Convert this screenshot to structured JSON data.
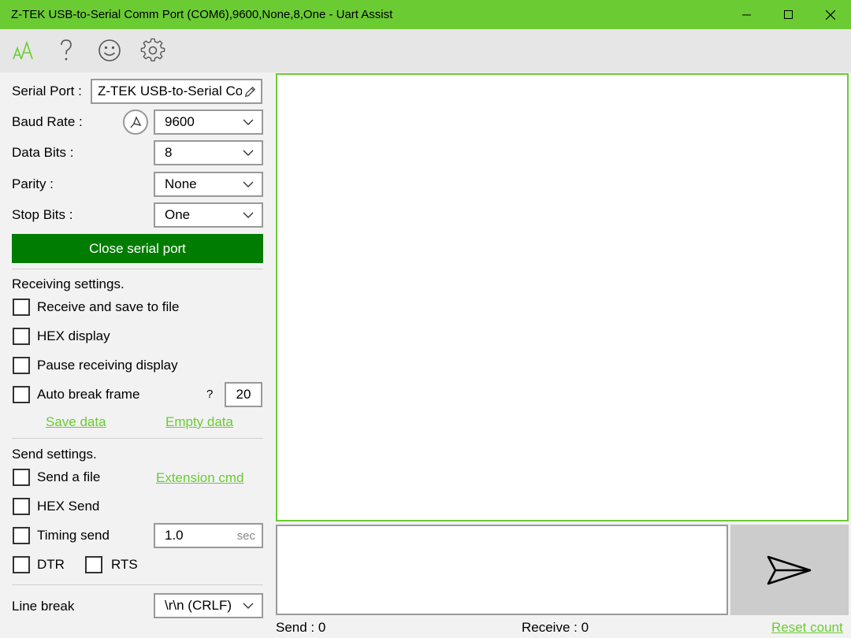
{
  "window": {
    "title": "Z-TEK USB-to-Serial Comm Port (COM6),9600,None,8,One - Uart Assist",
    "accent_color": "#6bcb33",
    "button_color": "#007d00",
    "controls": [
      "minimize-icon",
      "maximize-icon",
      "close-icon"
    ]
  },
  "toolbar": {
    "icons": [
      "font-size-icon",
      "help-icon",
      "smiley-icon",
      "gear-icon"
    ]
  },
  "serial": {
    "port_label": "Serial Port :",
    "port_value": "Z-TEK USB-to-Serial Com",
    "baud_label": "Baud Rate :",
    "baud_value": "9600",
    "data_bits_label": "Data Bits :",
    "data_bits_value": "8",
    "parity_label": "Parity :",
    "parity_value": "None",
    "stop_bits_label": "Stop Bits :",
    "stop_bits_value": "One",
    "close_button": "Close serial port"
  },
  "receiving": {
    "heading": "Receiving settings.",
    "save_to_file": "Receive and save to file",
    "hex_display": "HEX display",
    "pause_display": "Pause receiving display",
    "auto_break": "Auto break frame",
    "auto_break_help": "?",
    "auto_break_value": "20",
    "save_data": "Save data",
    "empty_data": "Empty data"
  },
  "sending": {
    "heading": "Send settings.",
    "send_file": "Send a file",
    "extension_cmd": "Extension cmd",
    "hex_send": "HEX Send",
    "timing_send": "Timing send",
    "timing_value": "1.0",
    "timing_unit": "sec",
    "dtr": "DTR",
    "rts": "RTS",
    "line_break_label": "Line break",
    "line_break_value": "\\r\\n (CRLF)"
  },
  "status": {
    "send_label": "Send : 0",
    "receive_label": "Receive : 0",
    "reset_count": "Reset count"
  }
}
